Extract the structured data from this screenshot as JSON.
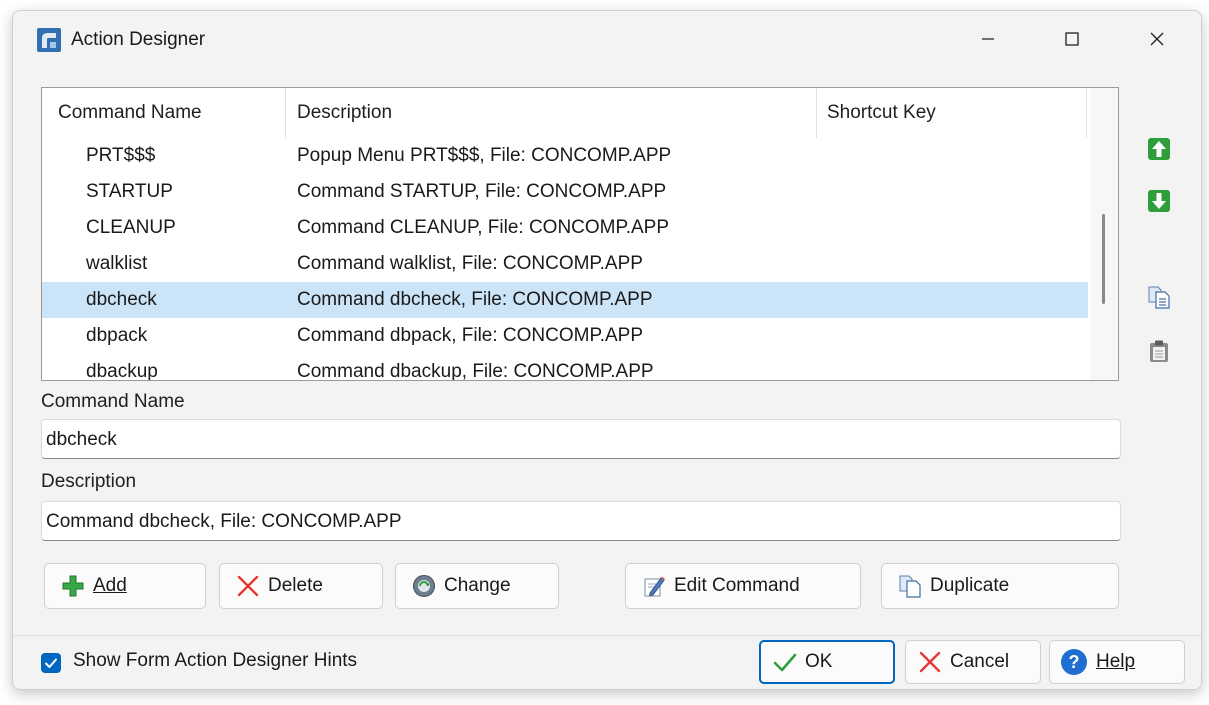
{
  "window": {
    "title": "Action Designer",
    "icons": {
      "app": "app-logo-icon",
      "minimize": "minimize-icon",
      "maximize": "maximize-icon",
      "close": "close-icon"
    }
  },
  "list": {
    "columns": [
      "Command Name",
      "Description",
      "Shortcut Key"
    ],
    "rows": [
      {
        "name": "PRT$$$",
        "description": "Popup Menu PRT$$$, File: CONCOMP.APP",
        "shortcut": ""
      },
      {
        "name": "STARTUP",
        "description": "Command STARTUP, File: CONCOMP.APP",
        "shortcut": ""
      },
      {
        "name": "CLEANUP",
        "description": "Command CLEANUP, File: CONCOMP.APP",
        "shortcut": ""
      },
      {
        "name": "walklist",
        "description": "Command walklist, File: CONCOMP.APP",
        "shortcut": ""
      },
      {
        "name": "dbcheck",
        "description": "Command dbcheck, File: CONCOMP.APP",
        "shortcut": "",
        "selected": true
      },
      {
        "name": "dbpack",
        "description": "Command dbpack, File: CONCOMP.APP",
        "shortcut": ""
      },
      {
        "name": "dbackup",
        "description": "Command dbackup, File: CONCOMP.APP",
        "shortcut": ""
      }
    ]
  },
  "side_tools": [
    "move-up-icon",
    "move-down-icon",
    "copy-icon",
    "paste-icon"
  ],
  "form": {
    "command_name_label": "Command Name",
    "command_name_value": "dbcheck",
    "description_label": "Description",
    "description_value": "Command dbcheck, File: CONCOMP.APP"
  },
  "actions": {
    "add": "Add",
    "delete": "Delete",
    "change": "Change",
    "edit_command": "Edit Command",
    "duplicate": "Duplicate"
  },
  "footer": {
    "hints_label": "Show Form Action Designer Hints",
    "hints_checked": true,
    "ok": "OK",
    "cancel": "Cancel",
    "help": "Help"
  },
  "colors": {
    "selection": "#cce4f7",
    "accent": "#0067c0",
    "green_arrow": "#2e9e3a"
  }
}
